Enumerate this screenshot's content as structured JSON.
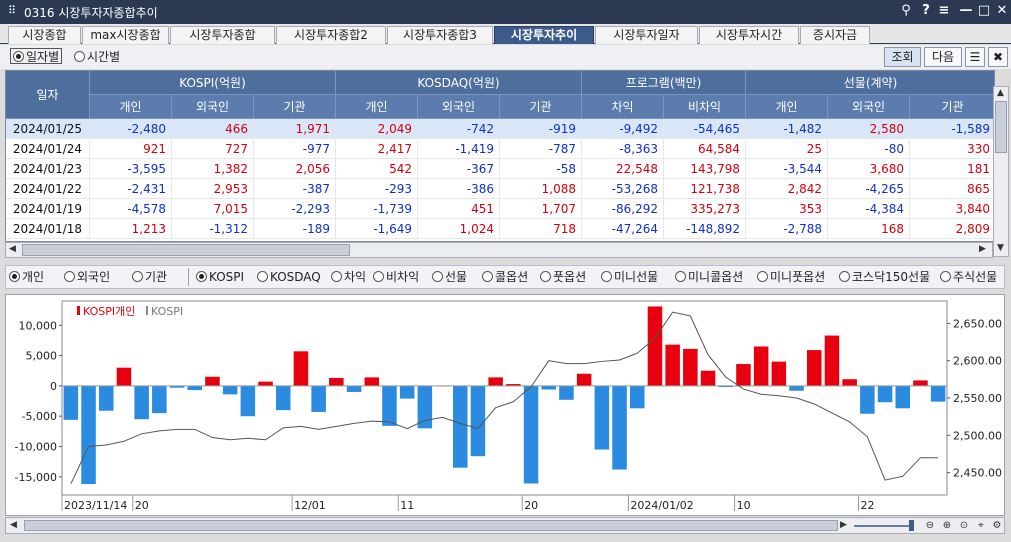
{
  "window": {
    "title": "0316 시장투자자종합추이",
    "grip_icon": "grid-grip-icon",
    "controls": [
      "pin-icon",
      "help-icon",
      "layout-icon",
      "minimize-icon",
      "maximize-icon",
      "close-icon"
    ],
    "control_glyphs": [
      "⚲",
      "?",
      "≡",
      "—",
      "□",
      "✕"
    ]
  },
  "tabs": [
    "시장종합",
    "max시장종합",
    "시장투자종합",
    "시장투자종합2",
    "시장투자종합3",
    "시장투자추이",
    "시장투자일자",
    "시장투자시간",
    "증시자금"
  ],
  "active_tab": "시장투자추이",
  "toolbar": {
    "period_options": [
      "일자별",
      "시간별"
    ],
    "period_selected": "일자별",
    "query_label": "조회",
    "next_label": "다음",
    "list_icon_glyph": "☰",
    "expand_icon_glyph": "✖"
  },
  "table": {
    "date_header": "일자",
    "groups": [
      "KOSPI(억원)",
      "KOSDAQ(억원)",
      "프로그램(백만)",
      "선물(계약)"
    ],
    "subheaders": [
      "개인",
      "외국인",
      "기관",
      "개인",
      "외국인",
      "기관",
      "차익",
      "비차익",
      "개인",
      "외국인",
      "기관"
    ],
    "rows": [
      {
        "date": "2024/01/25",
        "values": [
          "-2,480",
          "466",
          "1,971",
          "2,049",
          "-742",
          "-919",
          "-9,492",
          "-54,465",
          "-1,482",
          "2,580",
          "-1,589"
        ]
      },
      {
        "date": "2024/01/24",
        "values": [
          "921",
          "727",
          "-977",
          "2,417",
          "-1,419",
          "-787",
          "-8,363",
          "64,584",
          "25",
          "-80",
          "330"
        ]
      },
      {
        "date": "2024/01/23",
        "values": [
          "-3,595",
          "1,382",
          "2,056",
          "542",
          "-367",
          "-58",
          "22,548",
          "143,798",
          "-3,544",
          "3,680",
          "181"
        ]
      },
      {
        "date": "2024/01/22",
        "values": [
          "-2,431",
          "2,953",
          "-387",
          "-293",
          "-386",
          "1,088",
          "-53,268",
          "121,738",
          "2,842",
          "-4,265",
          "865"
        ]
      },
      {
        "date": "2024/01/19",
        "values": [
          "-4,578",
          "7,015",
          "-2,293",
          "-1,739",
          "451",
          "1,707",
          "-86,292",
          "335,273",
          "353",
          "-4,384",
          "3,840"
        ]
      },
      {
        "date": "2024/01/18",
        "values": [
          "1,213",
          "-1,312",
          "-189",
          "-1,649",
          "1,024",
          "718",
          "-47,264",
          "-148,892",
          "-2,788",
          "168",
          "2,809"
        ]
      }
    ]
  },
  "investor_options": [
    "개인",
    "외국인",
    "기관"
  ],
  "investor_selected": "개인",
  "market_options": [
    "KOSPI",
    "KOSDAQ",
    "차익",
    "비차익",
    "선물",
    "콜옵션",
    "풋옵션",
    "미니선물",
    "미니콜옵션",
    "미니풋옵션",
    "코스닥150선물",
    "주식선물"
  ],
  "market_selected": "KOSPI",
  "colors": {
    "positive": "#e8000f",
    "negative": "#2b8be0",
    "line": "#555555",
    "header": "#4e6e9e",
    "title_bar": "#2b3a52"
  },
  "chart_data": {
    "type": "bar",
    "legend": [
      "KOSPI개인",
      "KOSPI"
    ],
    "left_axis": {
      "ylim": [
        -18000,
        14000
      ],
      "ticks": [
        "10,000",
        "5,000",
        "0",
        "-5,000",
        "-10,000",
        "-15,000"
      ],
      "tick_values": [
        10000,
        5000,
        0,
        -5000,
        -10000,
        -15000
      ]
    },
    "right_axis": {
      "ylim": [
        2420,
        2680
      ],
      "ticks": [
        "2,650.00",
        "2,600.00",
        "2,550.00",
        "2,500.00",
        "2,450.00"
      ],
      "tick_values": [
        2650,
        2600,
        2550,
        2500,
        2450
      ]
    },
    "x_labels": [
      "2023/11/14",
      "20",
      "12/01",
      "11",
      "20",
      "2024/01/02",
      "10",
      "22"
    ],
    "x_label_index": [
      0,
      4,
      13,
      19,
      26,
      32,
      38,
      45
    ],
    "series": [
      {
        "name": "KOSPI개인",
        "values": [
          -5600,
          -16200,
          -4100,
          3000,
          -5500,
          -4500,
          -300,
          -700,
          1500,
          -1400,
          -5000,
          700,
          -4000,
          5700,
          -4300,
          1300,
          -1000,
          1400,
          -6600,
          -2100,
          -7000,
          0,
          -13500,
          -11600,
          1400,
          300,
          -16100,
          -600,
          -2300,
          2000,
          -10500,
          -13800,
          -3700,
          13100,
          6800,
          6100,
          2500,
          -200,
          3600,
          6500,
          4000,
          -800,
          5900,
          8300,
          1100,
          -4600,
          -2700,
          -3700,
          900,
          -2600
        ]
      },
      {
        "name": "KOSPI",
        "values": [
          2435,
          2485,
          2487,
          2492,
          2502,
          2506,
          2508,
          2508,
          2497,
          2494,
          2496,
          2494,
          2510,
          2512,
          2508,
          2512,
          2516,
          2519,
          2518,
          2509,
          2520,
          2524,
          2516,
          2509,
          2537,
          2545,
          2565,
          2600,
          2596,
          2596,
          2599,
          2601,
          2610,
          2630,
          2665,
          2660,
          2608,
          2578,
          2562,
          2555,
          2553,
          2550,
          2542,
          2530,
          2518,
          2498,
          2440,
          2445,
          2470,
          2470
        ]
      }
    ]
  }
}
